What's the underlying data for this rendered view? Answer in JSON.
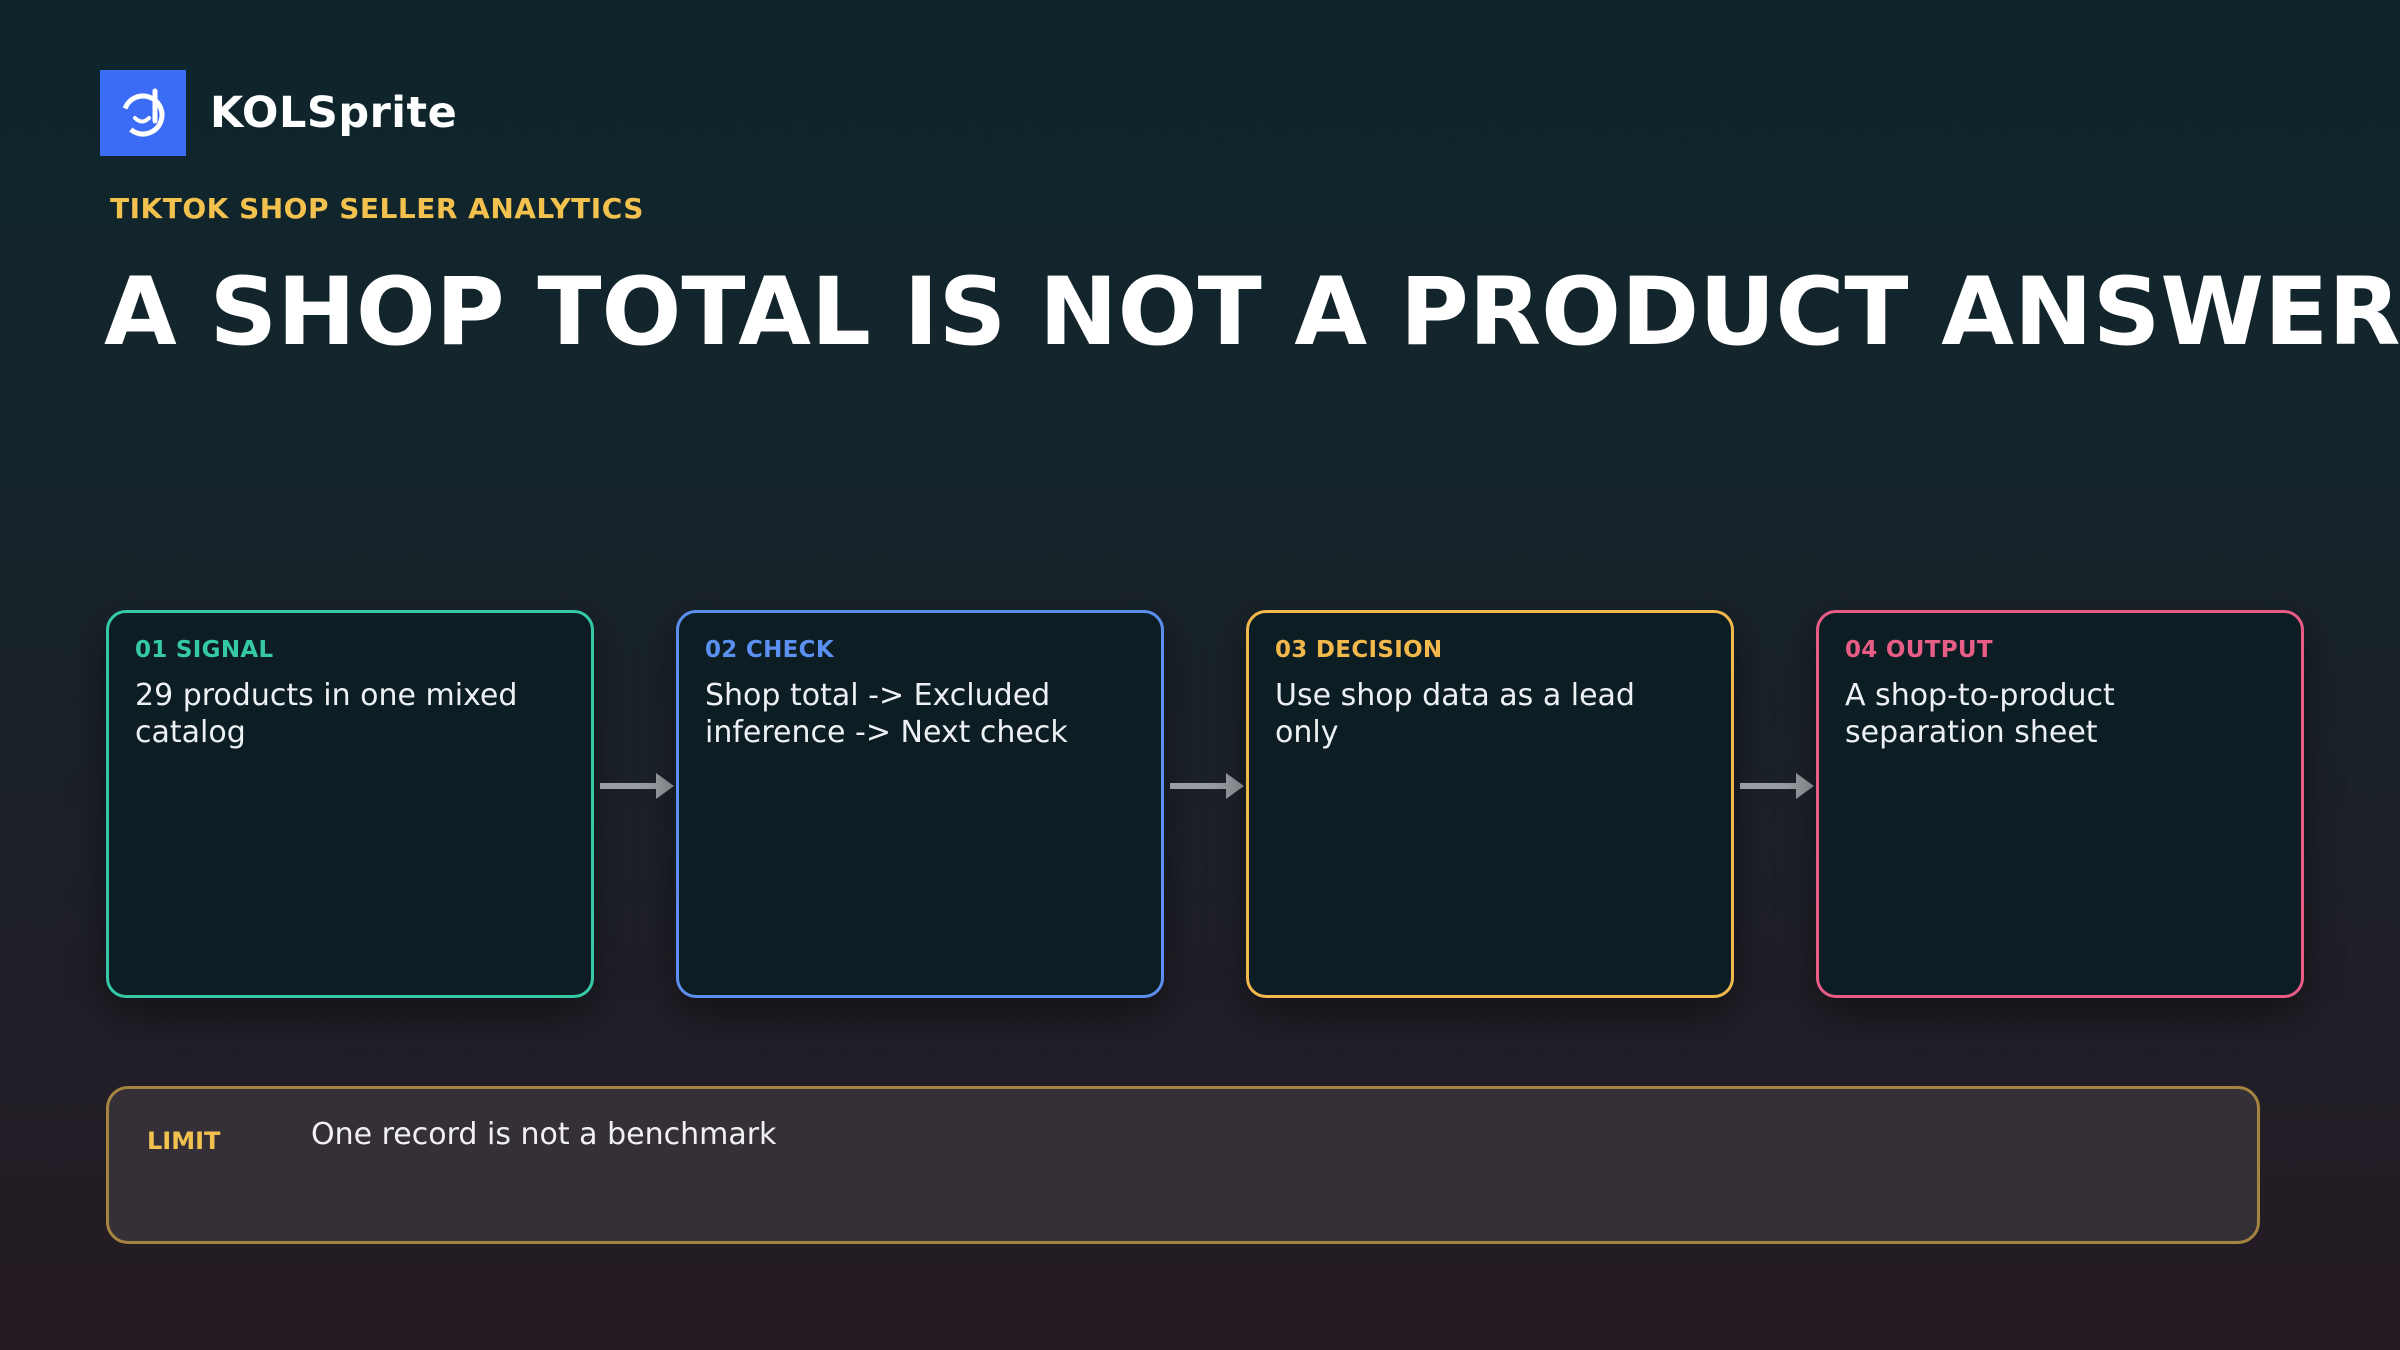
{
  "brand": {
    "name": "KOLSprite",
    "logo_icon": "smile-d-logo-icon",
    "logo_color": "#3b6cf5"
  },
  "header": {
    "eyebrow": "TIKTOK SHOP SELLER ANALYTICS",
    "title": "A SHOP TOTAL IS NOT A PRODUCT ANSWER"
  },
  "steps": [
    {
      "label": "01 SIGNAL",
      "text": "29 products in one mixed catalog",
      "color": "#35c9a6"
    },
    {
      "label": "02 CHECK",
      "text": "Shop total -> Excluded inference -> Next check",
      "color": "#5b8ff0"
    },
    {
      "label": "03 DECISION",
      "text": "Use shop data as a lead only",
      "color": "#f2b84b"
    },
    {
      "label": "04 OUTPUT",
      "text": "A shop-to-product separation sheet",
      "color": "#e85d86"
    }
  ],
  "connector_icon": "arrow-right-icon",
  "limit": {
    "label": "LIMIT",
    "text": "One record is not a benchmark",
    "color": "#f2c14e"
  }
}
